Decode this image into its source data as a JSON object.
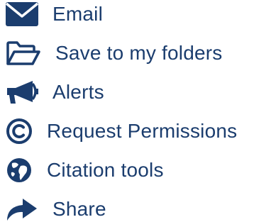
{
  "colors": {
    "primary": "#1b3d6e",
    "background": "#ffffff"
  },
  "menu": {
    "items": [
      {
        "label": "Email",
        "icon": "envelope-icon"
      },
      {
        "label": "Save to my folders",
        "icon": "folder-open-icon"
      },
      {
        "label": "Alerts",
        "icon": "megaphone-icon"
      },
      {
        "label": "Request Permissions",
        "icon": "copyright-icon"
      },
      {
        "label": "Citation tools",
        "icon": "globe-icon"
      },
      {
        "label": "Share",
        "icon": "share-arrow-icon"
      }
    ]
  }
}
